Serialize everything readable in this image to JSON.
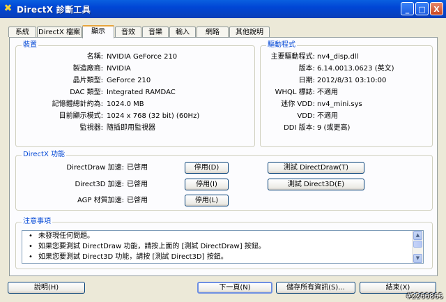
{
  "window": {
    "title": "DirectX 診斷工具",
    "minimize": "_",
    "maximize": "□",
    "close": "X"
  },
  "tabs": [
    "系統",
    "DirectX 檔案",
    "顯示",
    "音效",
    "音樂",
    "輸入",
    "網路",
    "其他說明"
  ],
  "active_tab": "顯示",
  "device": {
    "title": "裝置",
    "rows": [
      {
        "label": "名稱:",
        "value": "NVIDIA GeForce 210"
      },
      {
        "label": "製造廠商:",
        "value": "NVIDIA"
      },
      {
        "label": "晶片類型:",
        "value": "GeForce 210"
      },
      {
        "label": "DAC 類型:",
        "value": "Integrated RAMDAC"
      },
      {
        "label": "記憶體總計約為:",
        "value": "1024.0 MB"
      },
      {
        "label": "目前顯示模式:",
        "value": "1024 x 768 (32 bit) (60Hz)"
      },
      {
        "label": "監視器:",
        "value": "隨插即用監視器"
      }
    ]
  },
  "driver": {
    "title": "驅動程式",
    "rows": [
      {
        "label": "主要驅動程式:",
        "value": "nv4_disp.dll"
      },
      {
        "label": "版本:",
        "value": "6.14.0013.0623 (英文)"
      },
      {
        "label": "日期:",
        "value": "2012/8/31 03:10:00"
      },
      {
        "label": "WHQL 標誌:",
        "value": "不適用"
      },
      {
        "label": "迷你 VDD:",
        "value": "nv4_mini.sys"
      },
      {
        "label": "VDD:",
        "value": "不適用"
      },
      {
        "label": "DDI 版本:",
        "value": "9 (或更高)"
      }
    ]
  },
  "features": {
    "title": "DirectX 功能",
    "rows": [
      {
        "label": "DirectDraw 加速:",
        "value": "已啓用",
        "disable": "停用(D)",
        "test": "測試 DirectDraw(T)"
      },
      {
        "label": "Direct3D 加速:",
        "value": "已啓用",
        "disable": "停用(I)",
        "test": "測試 Direct3D(E)"
      },
      {
        "label": "AGP 材質加速:",
        "value": "已啓用",
        "disable": "停用(L)"
      }
    ]
  },
  "notes": {
    "title": "注意事項",
    "bullet": "•",
    "lines": [
      "未發現任何問題。",
      "如果您要測試 DirectDraw 功能，請按上面的 [測試 DirectDraw] 按鈕。",
      "如果您要測試 Direct3D 功能，請按 [測試 Direct3D] 按鈕。"
    ]
  },
  "buttons": {
    "help": "說明(H)",
    "next": "下一頁(N)",
    "save": "儲存所有資訊(S)...",
    "exit": "結束(X)"
  },
  "watermark": "#2266865"
}
